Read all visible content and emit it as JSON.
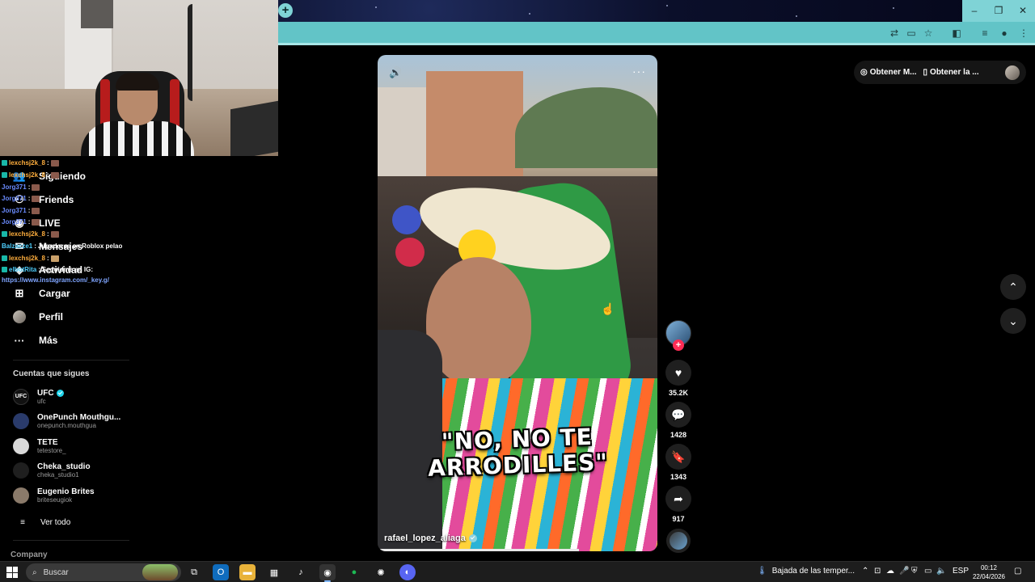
{
  "browser": {
    "new_tab_label": "+",
    "window_controls": {
      "minimize": "–",
      "restore": "❐",
      "close": "✕"
    },
    "toolbar_icons": [
      "translate-icon",
      "screen-share-icon",
      "bookmark-star-icon",
      "extensions-icon",
      "reading-list-icon",
      "profile-icon",
      "menu-kebab-icon"
    ]
  },
  "chat_overlay": {
    "lines": [
      {
        "user": "lexchsj2k_8",
        "sep": ":",
        "msg": "",
        "color": "orange"
      },
      {
        "user": "lexchsj2k_8",
        "sep": ":",
        "msg": "",
        "color": "orange"
      },
      {
        "user": "Jorg371",
        "sep": ":",
        "msg": "",
        "color": "blue"
      },
      {
        "user": "Jorg371",
        "sep": ":",
        "msg": "",
        "color": "blue"
      },
      {
        "user": "Jorg371",
        "sep": ":",
        "msg": "",
        "color": "blue"
      },
      {
        "user": "Jorg371",
        "sep": ":",
        "msg": "",
        "color": "blue"
      },
      {
        "user": "lexchsj2k_8",
        "sep": ":",
        "msg": "",
        "color": "orange"
      },
      {
        "user": "Balzacze1",
        "sep": ":",
        "msg": "Jugadores en Roblox pelao",
        "color": "cyan"
      },
      {
        "user": "lexchsj2k_8",
        "sep": ":",
        "msg": "",
        "color": "orange"
      },
      {
        "user": "elbotRita",
        "sep": ":",
        "msg": "Seguidme en IG:",
        "color": "cyan"
      }
    ],
    "link": "https://www.instagram.com/_key.g/"
  },
  "sidebar": {
    "nav": [
      {
        "label": "Siguiendo",
        "icon": "following-icon"
      },
      {
        "label": "Friends",
        "icon": "friends-icon"
      },
      {
        "label": "LIVE",
        "icon": "live-icon"
      },
      {
        "label": "Mensajes",
        "icon": "messages-icon"
      },
      {
        "label": "Actividad",
        "icon": "activity-icon"
      },
      {
        "label": "Cargar",
        "icon": "upload-icon"
      },
      {
        "label": "Perfil",
        "icon": "profile-avatar"
      },
      {
        "label": "Más",
        "icon": "more-dots-icon"
      }
    ],
    "following_title": "Cuentas que sigues",
    "accounts": [
      {
        "name": "UFC",
        "handle": "ufc",
        "verified": true,
        "color": "#111111"
      },
      {
        "name": "OnePunch Mouthgu...",
        "handle": "onepunch.mouthgua",
        "verified": false,
        "color": "#2a3b6b"
      },
      {
        "name": "TETE",
        "handle": "tetestore_",
        "verified": false,
        "color": "#d9d9d9"
      },
      {
        "name": "Cheka_studio",
        "handle": "cheka_studio1",
        "verified": false,
        "color": "#1f1f1f"
      },
      {
        "name": "Eugenio Brites",
        "handle": "briteseugiok",
        "verified": false,
        "color": "#8a7a6a"
      }
    ],
    "see_all": "Ver todo",
    "company": "Company"
  },
  "video": {
    "caption_line1": "\"NO, NO TE",
    "caption_line2": "ARRODILLES\"",
    "author": "rafael_lopez_aliaga",
    "author_verified": true,
    "progress": 0.72
  },
  "actions": {
    "likes": "35.2K",
    "comments": "1428",
    "saves": "1343",
    "shares": "917"
  },
  "top_right": {
    "get_app": "Obtener M...",
    "get_app2": "Obtener la ..."
  },
  "taskbar": {
    "search_placeholder": "Buscar",
    "weather": "Bajada de las temper...",
    "lang": "ESP",
    "time": "00:12",
    "date": "22/04/2026",
    "apps": [
      "task-view-icon",
      "outlook-icon",
      "file-explorer-icon",
      "store-icon",
      "tiktok-icon",
      "chrome-icon",
      "spotify-icon",
      "chatgpt-icon",
      "discord-icon"
    ]
  }
}
